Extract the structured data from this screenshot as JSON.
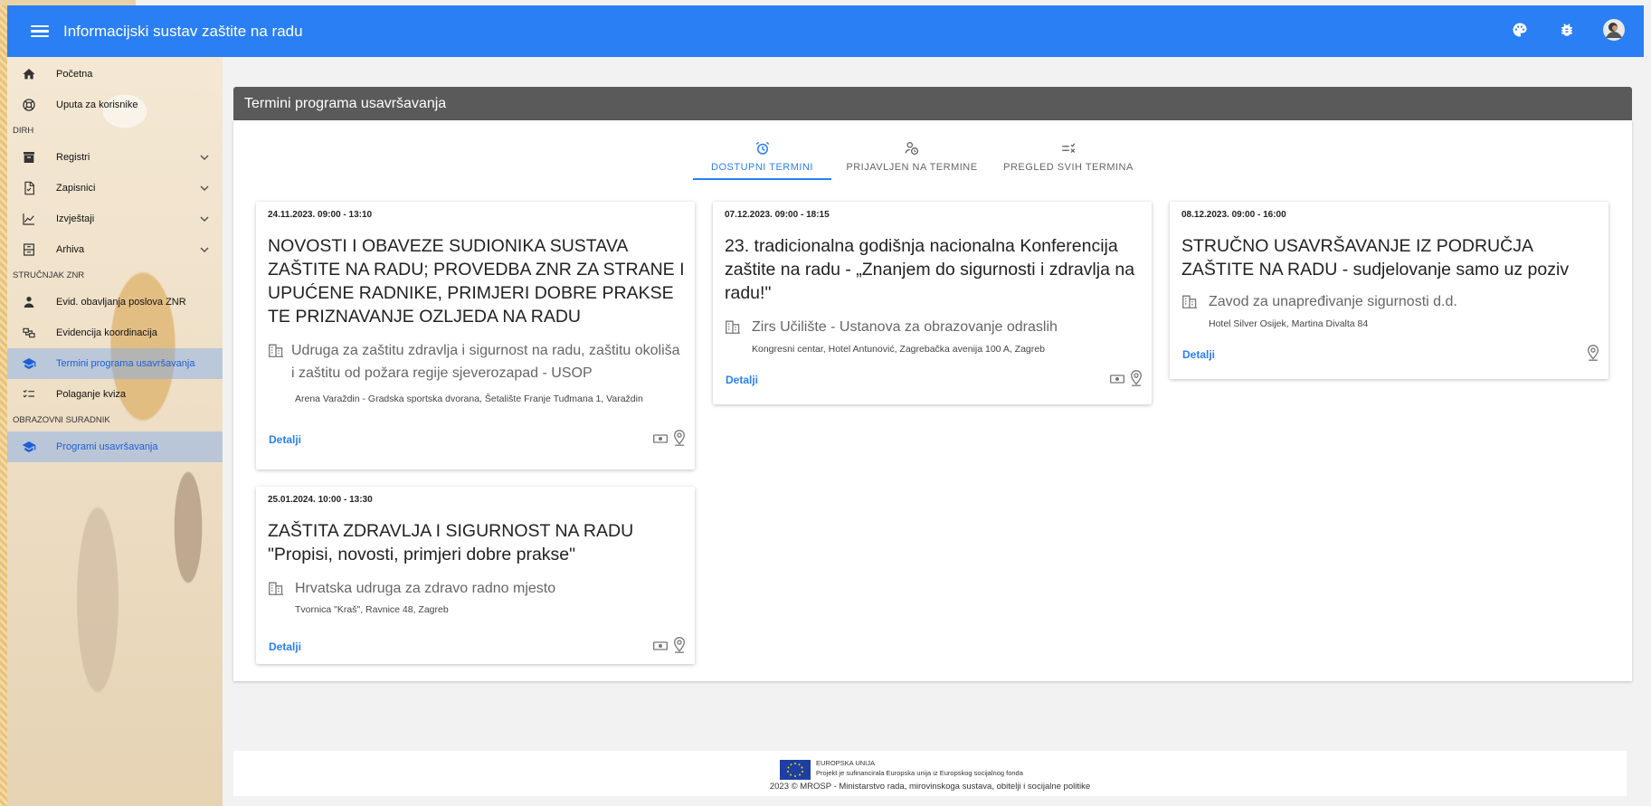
{
  "app": {
    "title": "Informacijski sustav zaštite na radu"
  },
  "sidebar": {
    "items_top": [
      {
        "label": "Početna",
        "icon": "home-icon"
      },
      {
        "label": "Uputa za korisnike",
        "icon": "help-icon"
      }
    ],
    "section_dirh": "DIRH",
    "items_dirh": [
      {
        "label": "Registri",
        "icon": "archive-icon"
      },
      {
        "label": "Zapisnici",
        "icon": "document-icon"
      },
      {
        "label": "Izvještaji",
        "icon": "chart-icon"
      },
      {
        "label": "Arhiva",
        "icon": "archive-box-icon"
      }
    ],
    "section_znr": "STRUČNJAK ZNR",
    "items_znr": [
      {
        "label": "Evid. obavljanja poslova ZNR",
        "icon": "person-icon"
      },
      {
        "label": "Evidencija koordinacija",
        "icon": "coordination-icon"
      },
      {
        "label": "Termini programa usavršavanja",
        "icon": "school-icon"
      },
      {
        "label": "Polaganje kviza",
        "icon": "checklist-icon"
      }
    ],
    "section_obr": "OBRAZOVNI SURADNIK",
    "items_obr": [
      {
        "label": "Programi usavršavanja",
        "icon": "school-icon"
      }
    ]
  },
  "panel": {
    "title": "Termini programa usavršavanja"
  },
  "tabs": [
    {
      "label": "DOSTUPNI TERMINI",
      "icon": "alarm-icon",
      "active": true
    },
    {
      "label": "PRIJAVLJEN NA TERMINE",
      "icon": "person-clock-icon",
      "active": false
    },
    {
      "label": "PREGLED SVIH TERMINA",
      "icon": "list-icon",
      "active": false
    }
  ],
  "cards": [
    {
      "date": "24.11.2023. 09:00 - 13:10",
      "title": "NOVOSTI I OBAVEZE SUDIONIKA SUSTAVA ZAŠTITE NA RADU; PROVEDBA ZNR ZA STRANE I UPUĆENE RADNIKE, PRIMJERI DOBRE PRAKSE TE PRIZNAVANJE OZLJEDA NA RADU",
      "org": "Udruga za zaštitu zdravlja i sigurnost na radu, zaštitu okoliša i zaštitu od požara regije sjeverozapad - USOP",
      "location": "Arena Varaždin - Gradska sportska dvorana, Šetalište Franje Tuđmana 1, Varaždin",
      "details": "Detalji"
    },
    {
      "date": "07.12.2023. 09:00 - 18:15",
      "title": "23. tradicionalna godišnja nacionalna Konferencija zaštite na radu - „Znanjem do sigurnosti i zdravlja na radu!\"",
      "org": "Zirs Učilište - Ustanova za obrazovanje odraslih",
      "location": "Kongresni centar, Hotel Antunović, Zagrebačka avenija 100 A, Zagreb",
      "details": "Detalji"
    },
    {
      "date": "08.12.2023. 09:00 - 16:00",
      "title": "STRUČNO USAVRŠAVANJE IZ PODRUČJA ZAŠTITE NA RADU - sudjelovanje samo uz poziv",
      "org": "Zavod za unapređivanje sigurnosti d.d.",
      "location": "Hotel Silver Osijek, Martina Divalta 84",
      "details": "Detalji"
    },
    {
      "date": "25.01.2024. 10:00 - 13:30",
      "title": "ZAŠTITA ZDRAVLJA I SIGURNOST NA RADU \"Propisi, novosti, primjeri dobre prakse\"",
      "org": "Hrvatska udruga za zdravo radno mjesto",
      "location": "Tvornica \"Kraš\", Ravnice 48, Zagreb",
      "details": "Detalji"
    }
  ],
  "footer": {
    "eu_line1": "EUROPSKA UNIJA",
    "eu_line2": "Projekt je sufinancirala Europska unija iz Europskog socijalnog fonda",
    "copyright": "2023 © MROSP - Ministarstvo rada, mirovinskoga sustava, obitelji i socijalne politike"
  },
  "colors": {
    "topbar": "#2a7ff4",
    "panel_header": "#5a5a5a",
    "link": "#2a7ff4"
  }
}
